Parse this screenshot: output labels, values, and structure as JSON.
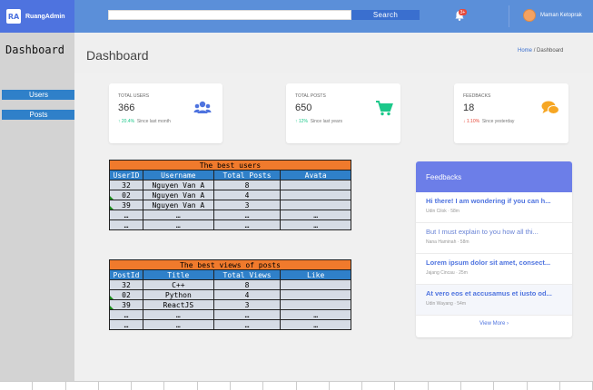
{
  "topbar": {
    "brand_logo": "RA",
    "brand_name": "RuangAdmin",
    "search_value": "",
    "search_button": "Search",
    "notification_count": "3+",
    "user_name": "Maman Ketoprak"
  },
  "sidebar": {
    "title": "Dashboard",
    "items": [
      {
        "label": "Users"
      },
      {
        "label": "Posts"
      }
    ]
  },
  "header": {
    "title": "Dashboard",
    "breadcrumb_home": "Home",
    "breadcrumb_sep": "/",
    "breadcrumb_current": "Dashboard"
  },
  "cards": [
    {
      "label": "TOTAL USERS",
      "value": "366",
      "delta": "20.4%",
      "delta_note": "Since last month",
      "trend": "up",
      "icon": "users-icon",
      "color": "#4e73df"
    },
    {
      "label": "TOTAL POSTS",
      "value": "650",
      "delta": "12%",
      "delta_note": "Since last years",
      "trend": "up",
      "icon": "cart-icon",
      "color": "#1cc88a"
    },
    {
      "label": "FEEDBACKS",
      "value": "18",
      "delta": "1.10%",
      "delta_note": "Since yesterday",
      "trend": "down",
      "icon": "comments-icon",
      "color": "#f6a623"
    }
  ],
  "users_table": {
    "caption": "The best users",
    "headers": [
      "UserID",
      "Username",
      "Total Posts",
      "Avata"
    ],
    "rows": [
      [
        "32",
        "Nguyen Van A",
        "8",
        ""
      ],
      [
        "02",
        "Nguyen Van A",
        "4",
        ""
      ],
      [
        "39",
        "Nguyen Van A",
        "3",
        ""
      ],
      [
        "…",
        "…",
        "…",
        "…"
      ],
      [
        "…",
        "…",
        "…",
        "…"
      ]
    ]
  },
  "posts_table": {
    "caption": "The best views of posts",
    "headers": [
      "PostId",
      "Title",
      "Total Views",
      "Like"
    ],
    "rows": [
      [
        "32",
        "C++",
        "8",
        ""
      ],
      [
        "02",
        "Python",
        "4",
        ""
      ],
      [
        "39",
        "ReactJS",
        "3",
        ""
      ],
      [
        "…",
        "…",
        "…",
        "…"
      ],
      [
        "…",
        "…",
        "…",
        "…"
      ]
    ]
  },
  "feedbacks": {
    "title": "Feedbacks",
    "items": [
      {
        "text": "Hi there! I am wondering if you can h...",
        "meta": "Udin Cilok · 58m"
      },
      {
        "text": "But I must explain to you how all thi...",
        "meta": "Nana Haminah · 58m"
      },
      {
        "text": "Lorem ipsum dolor sit amet, consect...",
        "meta": "Jajang Cincau · 25m"
      },
      {
        "text": "At vero eos et accusamus et iusto od...",
        "meta": "Udin Wayang · 54m"
      }
    ],
    "view_more": "View More"
  }
}
